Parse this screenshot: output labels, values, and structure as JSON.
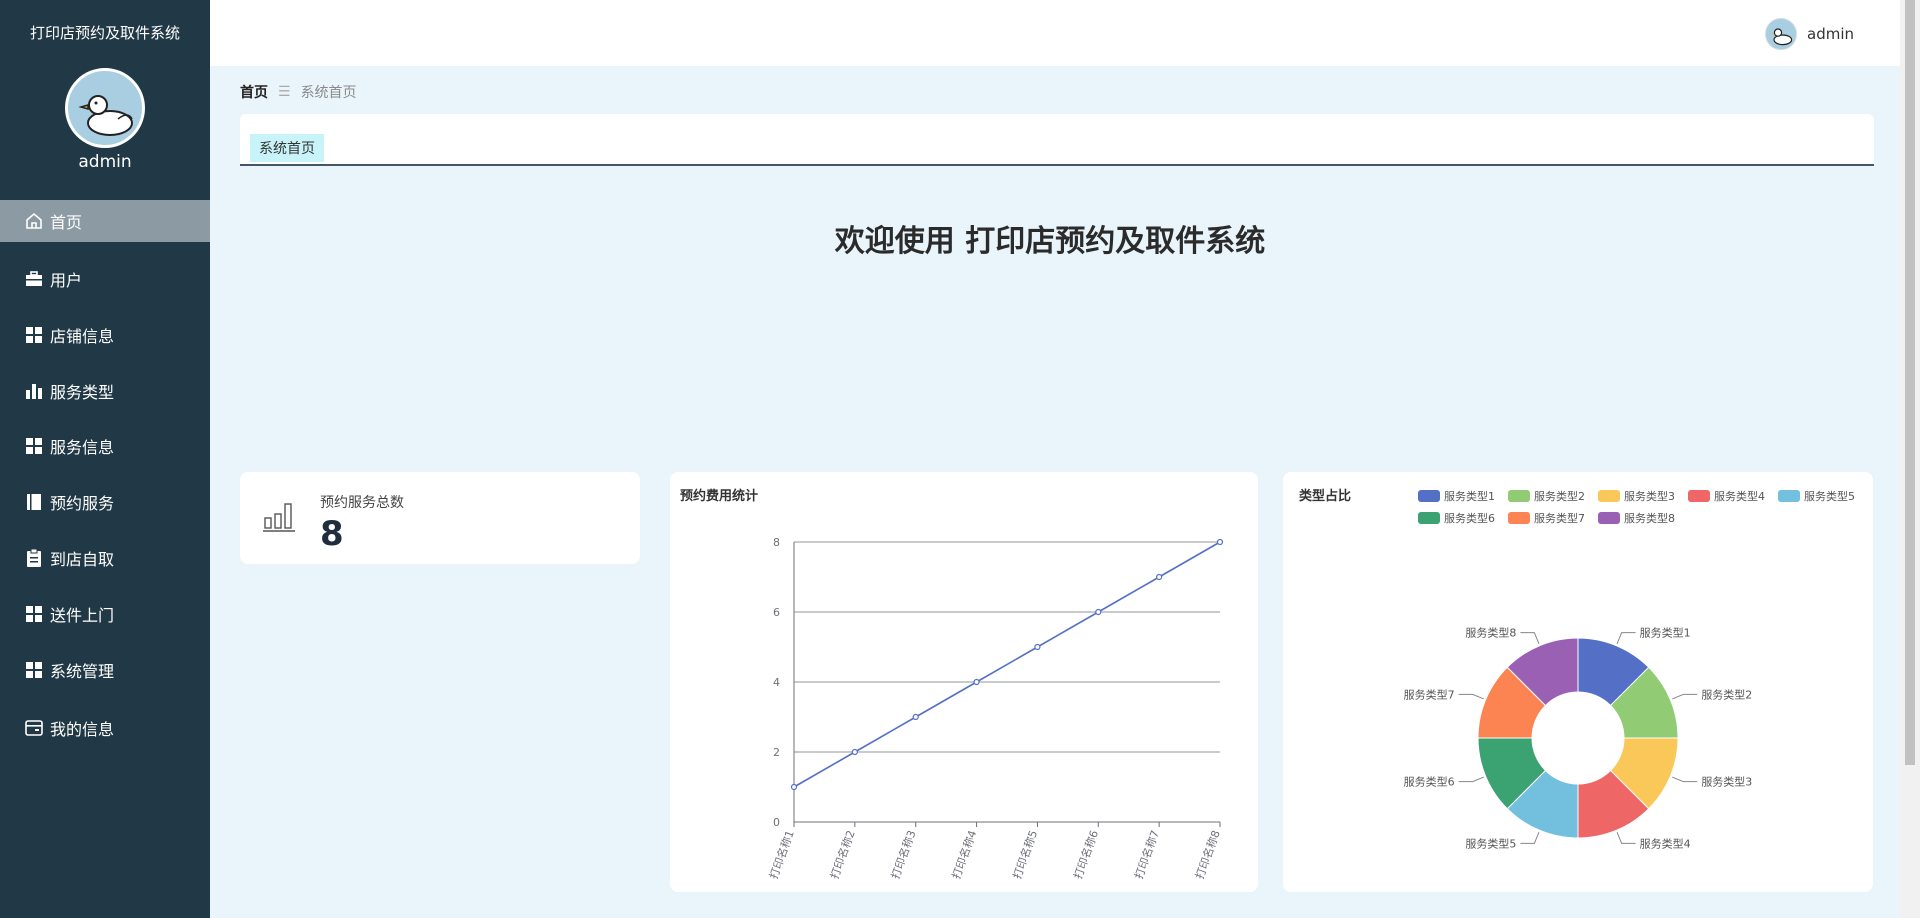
{
  "app": {
    "title": "打印店预约及取件系统",
    "username": "admin"
  },
  "sidebar": {
    "items": [
      {
        "label": "首页",
        "icon": "home-icon",
        "active": true
      },
      {
        "label": "用户",
        "icon": "briefcase-icon"
      },
      {
        "label": "店铺信息",
        "icon": "grid-icon"
      },
      {
        "label": "服务类型",
        "icon": "bar-chart-icon"
      },
      {
        "label": "服务信息",
        "icon": "grid-icon"
      },
      {
        "label": "预约服务",
        "icon": "book-icon"
      },
      {
        "label": "到店自取",
        "icon": "clipboard-icon"
      },
      {
        "label": "送件上门",
        "icon": "grid-icon"
      },
      {
        "label": "系统管理",
        "icon": "grid-icon"
      },
      {
        "label": "我的信息",
        "icon": "card-icon"
      }
    ]
  },
  "header": {
    "username": "admin"
  },
  "breadcrumb": {
    "home": "首页",
    "separator": "☰",
    "current": "系统首页"
  },
  "tabs": [
    {
      "label": "系统首页"
    }
  ],
  "welcome": {
    "text": "欢迎使用 打印店预约及取件系统"
  },
  "stat": {
    "label": "预约服务总数",
    "value": "8"
  },
  "colors": {
    "sidebar_bg": "#213846",
    "active_item": "#8c9ba3",
    "page_bg": "#eaf5fb",
    "tab_bg": "#c8f3f8",
    "line_color": "#5470c6"
  },
  "chart_data": [
    {
      "type": "line",
      "title": "预约费用统计",
      "categories": [
        "打印名称1",
        "打印名称2",
        "打印名称3",
        "打印名称4",
        "打印名称5",
        "打印名称6",
        "打印名称7",
        "打印名称8"
      ],
      "values": [
        1,
        2,
        3,
        4,
        5,
        6,
        7,
        8
      ],
      "ylim": [
        0,
        8
      ],
      "yticks": [
        0,
        2,
        4,
        6,
        8
      ],
      "grid": true
    },
    {
      "type": "pie",
      "title": "类型占比",
      "variant": "donut",
      "legend_position": "top",
      "labels": [
        "服务类型1",
        "服务类型2",
        "服务类型3",
        "服务类型4",
        "服务类型5",
        "服务类型6",
        "服务类型7",
        "服务类型8"
      ],
      "values": [
        1,
        1,
        1,
        1,
        1,
        1,
        1,
        1
      ],
      "colors": [
        "#5470c6",
        "#91cc75",
        "#fac858",
        "#ee6666",
        "#73c0de",
        "#3ba272",
        "#fc8452",
        "#9a60b4"
      ]
    }
  ]
}
